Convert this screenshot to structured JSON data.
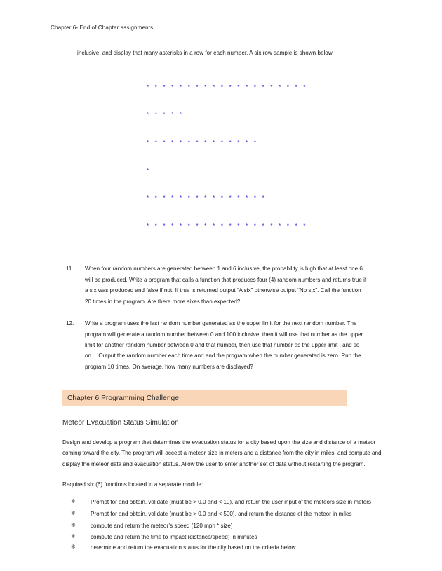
{
  "document": {
    "running_header": "Chapter 6- End of Chapter assignments"
  },
  "continued_paragraph": {
    "text": "inclusive, and display that many asterisks in a row for each number.  A six row sample is shown below."
  },
  "ascii_art": {
    "rows": [
      "* * * * * * * * * * * * * * * * * * * *",
      "* * * * *",
      "* * * * * * * * * * * * * *",
      "*",
      "* * * * * * * * * * * * * * *",
      "* * * * * * * * * * * * * * * * * * * *"
    ],
    "color": "#3a34d8"
  },
  "numbered_items": [
    {
      "number": "11.",
      "text": "When four random numbers are generated between 1 and 6 inclusive, the probability is high that at least one 6 will be produced.  Write a program that calls  a function that produces four (4) random numbers and returns true if a six was produced and false if not.  If true is returned output “A six” otherwise output “No six”.  Call the function 20 times in the program.  Are there more sixes than expected?"
    },
    {
      "number": "12.",
      "text": "Write a program uses the last random number generated as the upper limit for the next random number.  The program will generate a random number between 0 and 100 inclusive, then it will use that number as the upper limit for another random number between 0 and that number, then use that number as the upper limit , and so on…   Output the random number each time and end the program when the number generated is zero. Run the program 10 times.  On average, how many numbers are displayed?"
    }
  ],
  "section": {
    "heading": "Chapter 6 Programming Challenge",
    "heading_highlight_color": "#fad6b8",
    "subtitle": "Meteor Evacuation Status Simulation",
    "body": "Design and develop a program that determines the evacuation status for a city  based upon the size and distance of a meteor coming toward the city.  The program will accept a meteor size in meters and a distance from the city in miles, and compute and display the meteor data and evacuation status.  Allow the user to enter another set of data without restarting the program.",
    "required_line": "Required six (6) functions located in a separate module:",
    "bullet_glyph": "✱",
    "bullets": [
      "Prompt for and obtain, validate (must be > 0.0 and < 10), and return the user input of the meteors size in meters",
      "Prompt for and obtain, validate (must be > 0.0 and < 500), and return the distance of the meteor in miles",
      "compute and return the meteor’s speed (120 mph * size)",
      "compute and return the time to impact (distance/speed) in minutes",
      "determine and return the evacuation status for the city  based on the criteria below"
    ]
  }
}
